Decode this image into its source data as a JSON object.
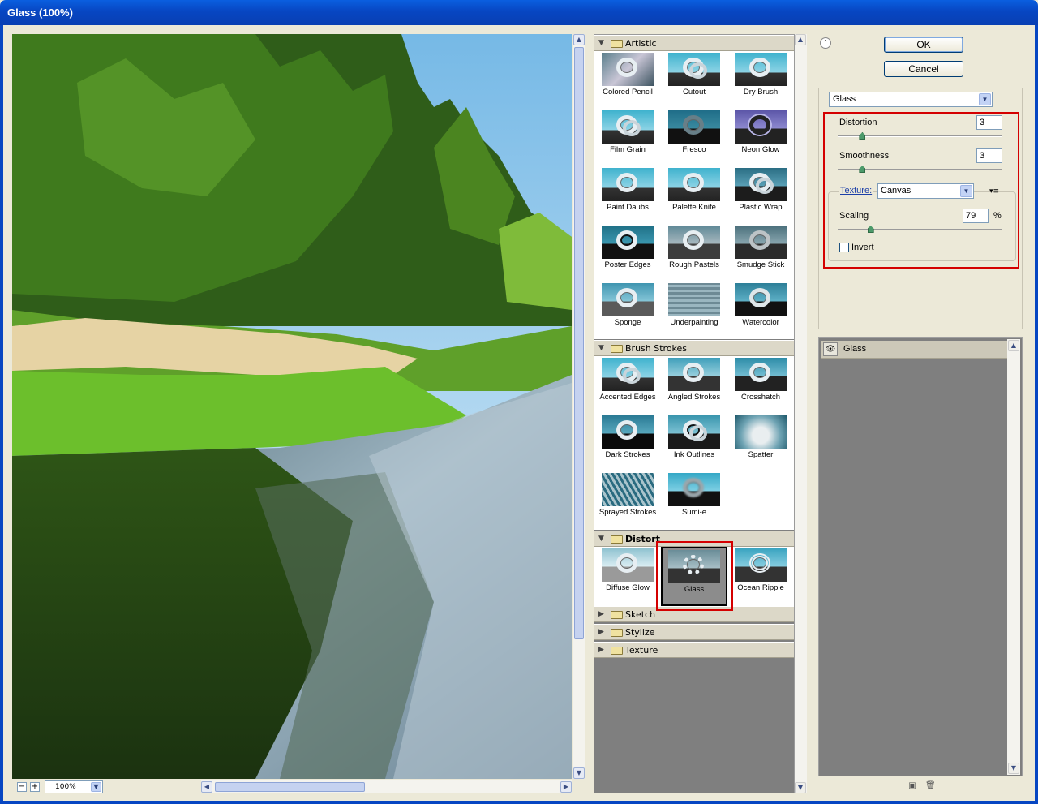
{
  "window": {
    "title": "Glass (100%)"
  },
  "zoom": {
    "minus": "−",
    "plus": "+",
    "value": "100%"
  },
  "gallery": {
    "categories": [
      {
        "name": "Artistic",
        "expanded": true,
        "filters": [
          "Colored Pencil",
          "Cutout",
          "Dry Brush",
          "Film Grain",
          "Fresco",
          "Neon Glow",
          "Paint Daubs",
          "Palette Knife",
          "Plastic Wrap",
          "Poster Edges",
          "Rough Pastels",
          "Smudge Stick",
          "Sponge",
          "Underpainting",
          "Watercolor"
        ]
      },
      {
        "name": "Brush Strokes",
        "expanded": true,
        "filters": [
          "Accented Edges",
          "Angled Strokes",
          "Crosshatch",
          "Dark Strokes",
          "Ink Outlines",
          "Spatter",
          "Sprayed Strokes",
          "Sumi-e"
        ]
      },
      {
        "name": "Distort",
        "expanded": true,
        "filters": [
          "Diffuse Glow",
          "Glass",
          "Ocean Ripple"
        ],
        "selected": "Glass"
      },
      {
        "name": "Sketch",
        "expanded": false
      },
      {
        "name": "Stylize",
        "expanded": false
      },
      {
        "name": "Texture",
        "expanded": false
      }
    ]
  },
  "buttons": {
    "ok": "OK",
    "cancel": "Cancel"
  },
  "settings": {
    "filter": "Glass",
    "distortion": {
      "label": "Distortion",
      "value": "3",
      "level": 0.15
    },
    "smoothness": {
      "label": "Smoothness",
      "value": "3",
      "level": 0.15
    },
    "texture": {
      "label": "Texture:",
      "value": "Canvas"
    },
    "scaling": {
      "label": "Scaling",
      "value": "79",
      "unit": "%",
      "level": 0.2
    },
    "invert": {
      "label": "Invert",
      "checked": false
    }
  },
  "layers": {
    "items": [
      {
        "name": "Glass",
        "visible": true
      }
    ]
  }
}
